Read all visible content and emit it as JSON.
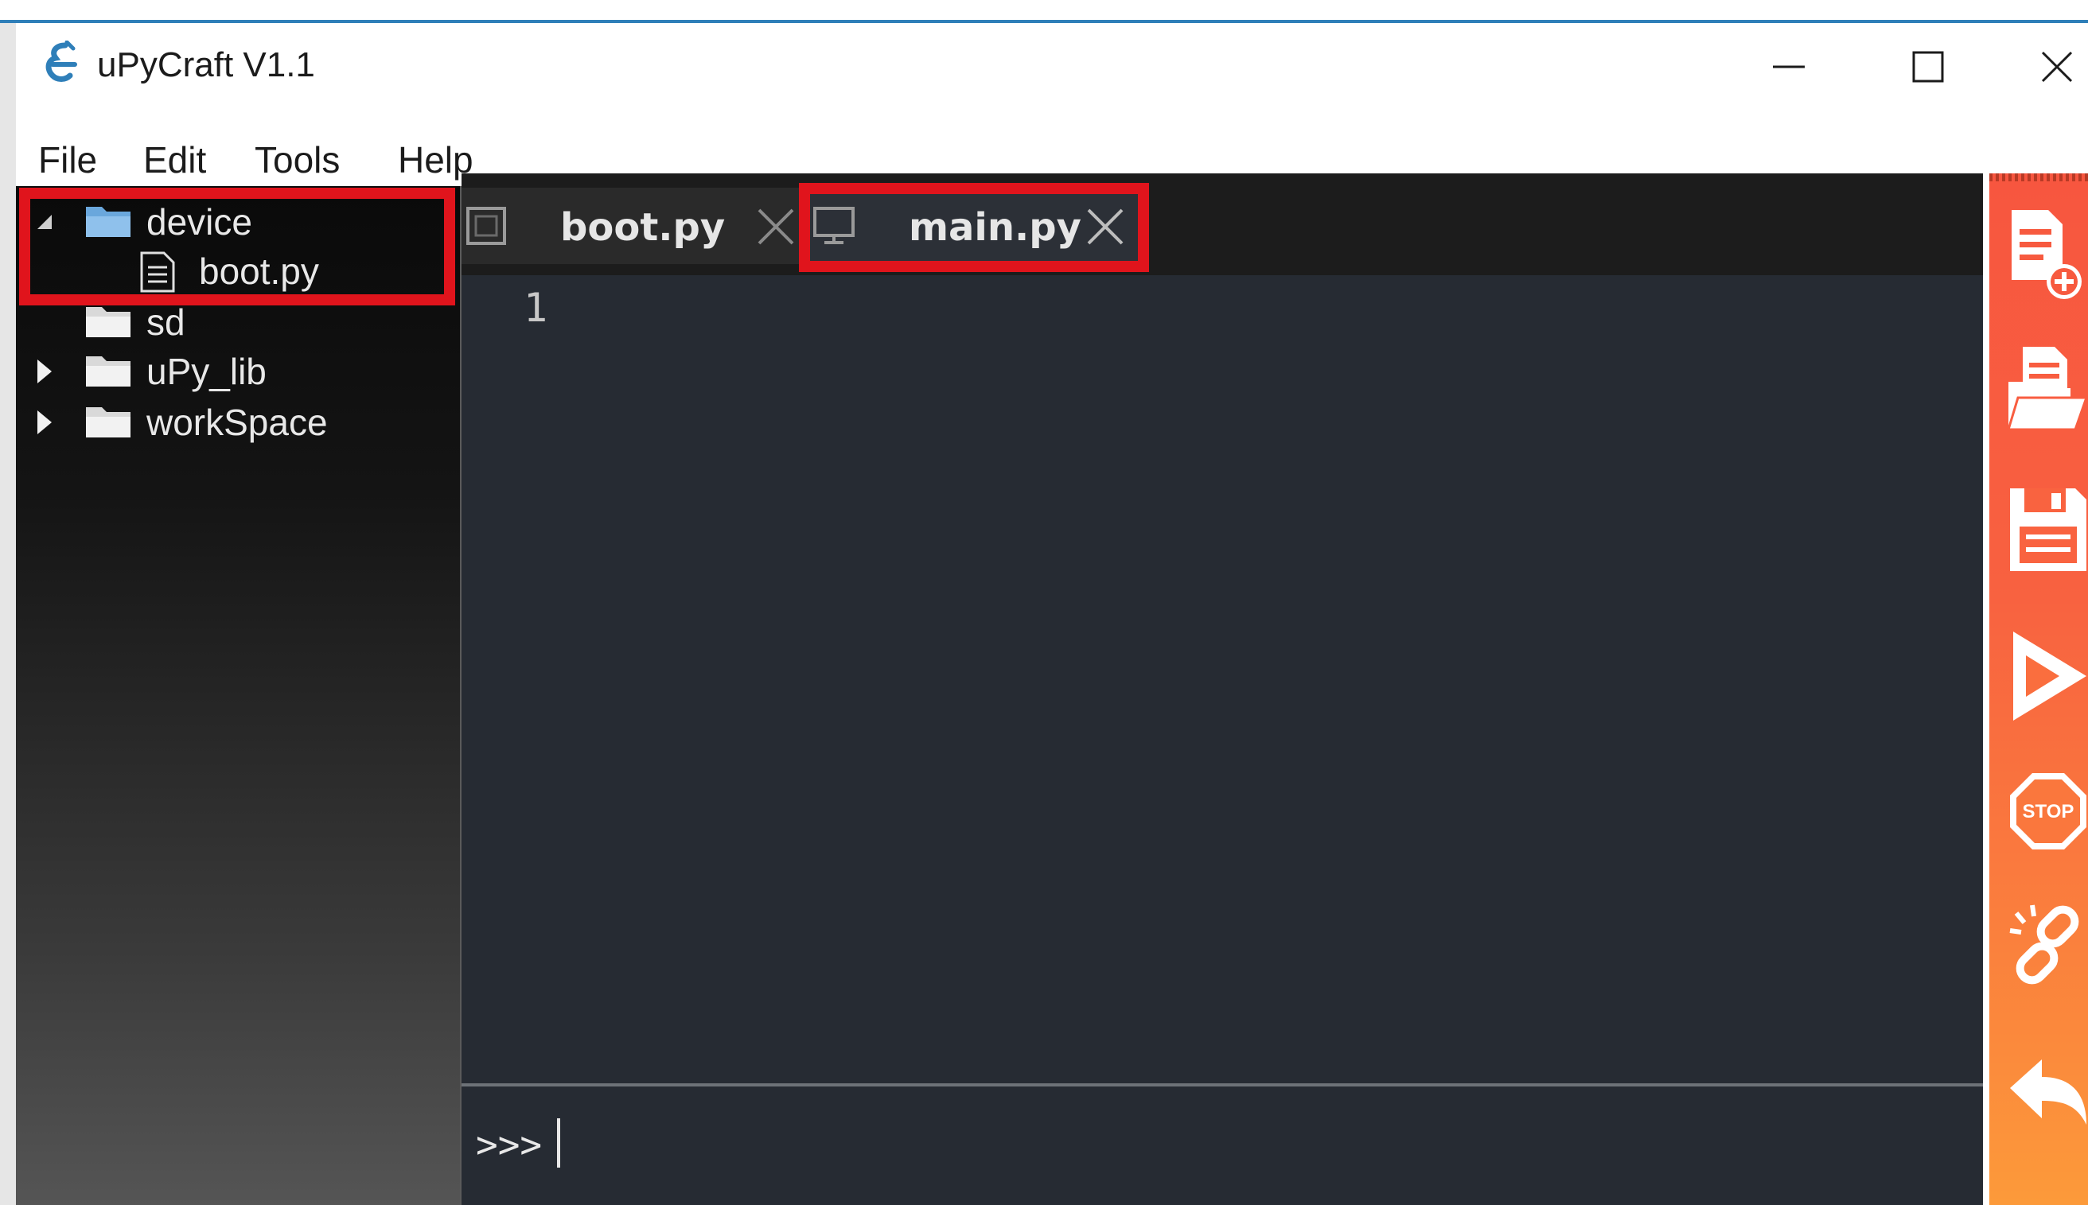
{
  "window": {
    "title": "uPyCraft V1.1"
  },
  "menu": {
    "items": [
      "File",
      "Edit",
      "Tools",
      "Help"
    ]
  },
  "file_tree": {
    "items": [
      {
        "label": "device",
        "expanded": true,
        "icon": "folder-icon"
      },
      {
        "label": "boot.py",
        "icon": "file-icon"
      },
      {
        "label": "sd",
        "icon": "folder-icon"
      },
      {
        "label": "uPy_lib",
        "expanded": false,
        "icon": "folder-icon"
      },
      {
        "label": "workSpace",
        "expanded": false,
        "icon": "folder-icon"
      }
    ]
  },
  "tabs": [
    {
      "label": "boot.py",
      "active": false
    },
    {
      "label": "main.py",
      "active": true
    }
  ],
  "editor": {
    "line_numbers": [
      "1"
    ]
  },
  "console": {
    "prompt": ">>>"
  },
  "toolbar": {
    "buttons": [
      "new-file-icon",
      "open-file-icon",
      "save-icon",
      "run-icon",
      "stop-icon",
      "connect-icon",
      "undo-icon"
    ]
  },
  "colors": {
    "highlight": "#e0141c",
    "toolbar_top": "#f7563f",
    "toolbar_bottom": "#fc9a3a",
    "editor_bg": "#262b33",
    "accent_line": "#2f7fb9"
  }
}
